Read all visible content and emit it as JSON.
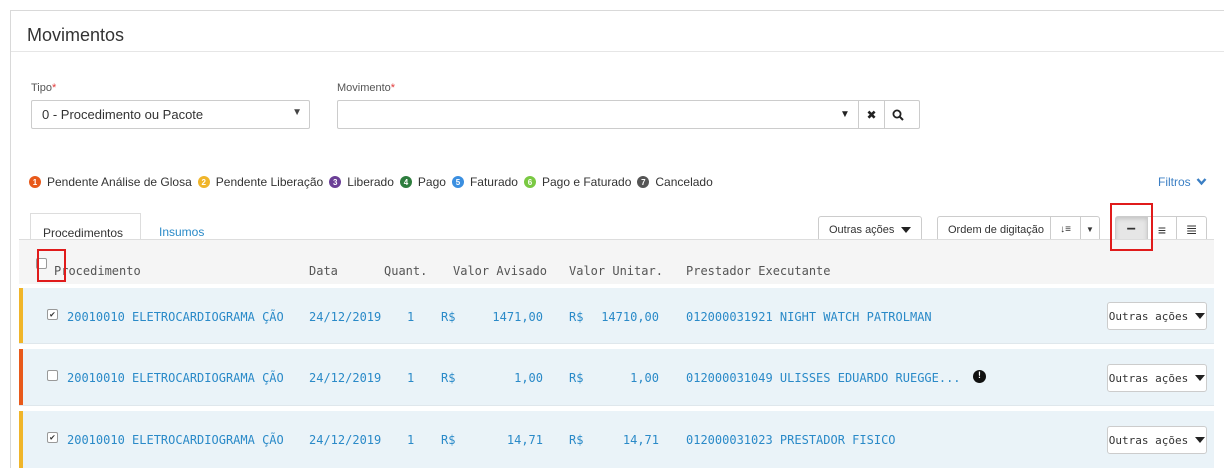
{
  "page": {
    "title": "Movimentos"
  },
  "form": {
    "tipo_label": "Tipo",
    "tipo_value": "0 - Procedimento ou Pacote",
    "movimento_label": "Movimento",
    "movimento_value": "",
    "required_mark": "*"
  },
  "legend": [
    {
      "num": "1",
      "label": "Pendente Análise de Glosa",
      "color": "#e8591a"
    },
    {
      "num": "2",
      "label": "Pendente Liberação",
      "color": "#f0b52a"
    },
    {
      "num": "3",
      "label": "Liberado",
      "color": "#6b3f96"
    },
    {
      "num": "4",
      "label": "Pago",
      "color": "#2e7d3e"
    },
    {
      "num": "5",
      "label": "Faturado",
      "color": "#3b8fe0"
    },
    {
      "num": "6",
      "label": "Pago e Faturado",
      "color": "#7ac943"
    },
    {
      "num": "7",
      "label": "Cancelado",
      "color": "#555555"
    }
  ],
  "filtros_label": "Filtros",
  "tabs": [
    {
      "label": "Procedimentos",
      "active": true
    },
    {
      "label": "Insumos",
      "active": false
    }
  ],
  "toolbar": {
    "outras_acoes": "Outras ações",
    "ordem": "Ordem de digitação"
  },
  "table": {
    "headers": [
      "Procedimento",
      "Data",
      "Quant.",
      "Valor Avisado",
      "Valor Unitar.",
      "Prestador Executante"
    ],
    "rows": [
      {
        "checked": true,
        "status_color": "#f0b52a",
        "procedimento": "20010010 ELETROCARDIOGRAMA ÇÃO",
        "data": "24/12/2019",
        "quant": "1",
        "cur1": "R$",
        "avisado": "1471,00",
        "cur2": "R$",
        "unitar": "14710,00",
        "prestador": "012000031921 NIGHT WATCH PATROLMAN",
        "warning": false,
        "action": "Outras ações"
      },
      {
        "checked": false,
        "status_color": "#e8591a",
        "procedimento": "20010010 ELETROCARDIOGRAMA ÇÃO",
        "data": "24/12/2019",
        "quant": "1",
        "cur1": "R$",
        "avisado": "1,00",
        "cur2": "R$",
        "unitar": "1,00",
        "prestador": "012000031049 ULISSES EDUARDO RUEGGE...",
        "warning": true,
        "action": "Outras ações"
      },
      {
        "checked": true,
        "status_color": "#f0b52a",
        "procedimento": "20010010 ELETROCARDIOGRAMA ÇÃO",
        "data": "24/12/2019",
        "quant": "1",
        "cur1": "R$",
        "avisado": "14,71",
        "cur2": "R$",
        "unitar": "14,71",
        "prestador": "012000031023 PRESTADOR FISICO",
        "warning": false,
        "action": "Outras ações"
      }
    ]
  },
  "icons": {
    "caret": "▼",
    "close": "✖",
    "check": "✔",
    "warning": "!",
    "sort": "↓≡",
    "compact": "−",
    "list": "≡",
    "detailed": "≣"
  },
  "colors": {
    "accent": "#2a8ac8",
    "row_bg": "#eaf3f8",
    "highlight": "#e01b1b"
  }
}
